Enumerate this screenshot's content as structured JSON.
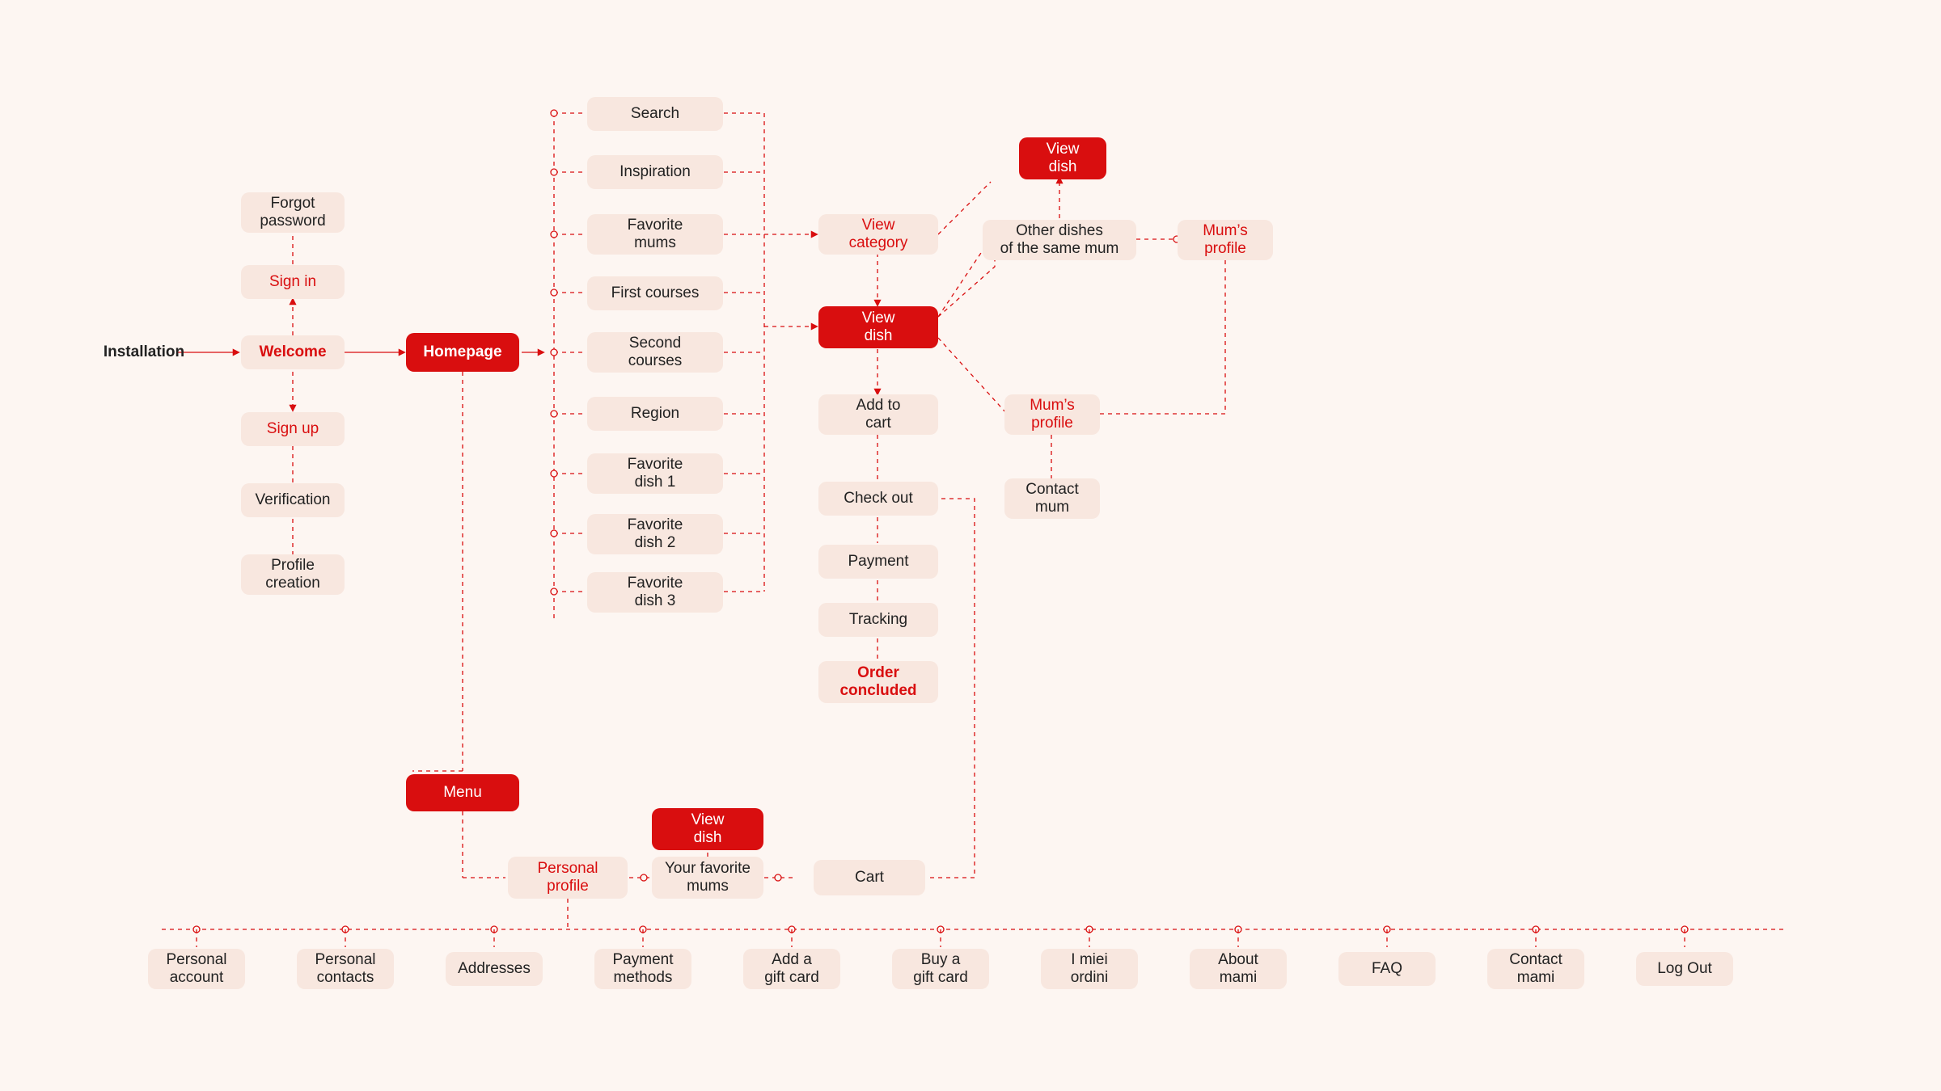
{
  "nodes": {
    "installation": {
      "l1": "Installation"
    },
    "forgot_pw": {
      "l1": "Forgot",
      "l2": "password"
    },
    "signin": {
      "l1": "Sign in"
    },
    "welcome": {
      "l1": "Welcome"
    },
    "signup": {
      "l1": "Sign up"
    },
    "verification": {
      "l1": "Verification"
    },
    "profile_cr": {
      "l1": "Profile",
      "l2": "creation"
    },
    "homepage": {
      "l1": "Homepage"
    },
    "search": {
      "l1": "Search"
    },
    "inspiration": {
      "l1": "Inspiration"
    },
    "fav_mums": {
      "l1": "Favorite",
      "l2": "mums"
    },
    "first": {
      "l1": "First courses"
    },
    "second": {
      "l1": "Second",
      "l2": "courses"
    },
    "region": {
      "l1": "Region"
    },
    "fav_d1": {
      "l1": "Favorite",
      "l2": "dish 1"
    },
    "fav_d2": {
      "l1": "Favorite",
      "l2": "dish 2"
    },
    "fav_d3": {
      "l1": "Favorite",
      "l2": "dish 3"
    },
    "view_cat": {
      "l1": "View",
      "l2": "category"
    },
    "view_dish": {
      "l1": "View",
      "l2": "dish"
    },
    "add_cart": {
      "l1": "Add to",
      "l2": "cart"
    },
    "checkout": {
      "l1": "Check out"
    },
    "payment": {
      "l1": "Payment"
    },
    "tracking": {
      "l1": "Tracking"
    },
    "order_done": {
      "l1": "Order",
      "l2": "concluded"
    },
    "view_dish_top": {
      "l1": "View",
      "l2": "dish"
    },
    "other_dishes": {
      "l1": "Other dishes",
      "l2": "of the same mum"
    },
    "mums_prof_r": {
      "l1": "Mum’s",
      "l2": "profile"
    },
    "mums_prof_b": {
      "l1": "Mum’s",
      "l2": "profile"
    },
    "contact_mum": {
      "l1": "Contact",
      "l2": "mum"
    },
    "menu": {
      "l1": "Menu"
    },
    "view_dish_b": {
      "l1": "View",
      "l2": "dish"
    },
    "your_fav": {
      "l1": "Your favorite",
      "l2": "mums"
    },
    "personal_prof": {
      "l1": "Personal",
      "l2": "profile"
    },
    "cart": {
      "l1": "Cart"
    }
  },
  "bottom_row": [
    {
      "l1": "Personal",
      "l2": "account"
    },
    {
      "l1": "Personal",
      "l2": "contacts"
    },
    {
      "l1": "Addresses"
    },
    {
      "l1": "Payment",
      "l2": "methods"
    },
    {
      "l1": "Add a",
      "l2": "gift card"
    },
    {
      "l1": "Buy a",
      "l2": "gift card"
    },
    {
      "l1": "I miei",
      "l2": "ordini"
    },
    {
      "l1": "About",
      "l2": "mami"
    },
    {
      "l1": "FAQ"
    },
    {
      "l1": "Contact",
      "l2": "mami"
    },
    {
      "l1": "Log Out"
    }
  ]
}
